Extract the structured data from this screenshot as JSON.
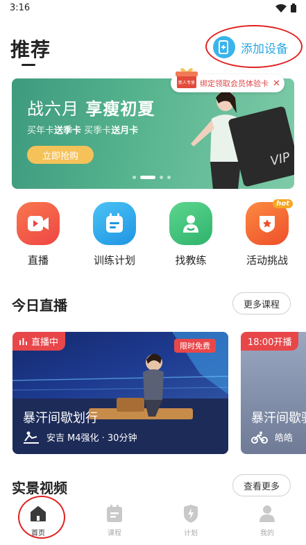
{
  "status_bar": {
    "time": "3:16"
  },
  "header": {
    "title": "推荐",
    "add_device_label": "添加设备"
  },
  "banner": {
    "title_part1": "战六月",
    "title_part2": "享瘦初夏",
    "subtitle_part1": "买年卡",
    "subtitle_part2": "送季卡",
    "subtitle_part3": "买季卡",
    "subtitle_part4": "送月卡",
    "button_label": "立即抢购",
    "card_text": "VIP",
    "slide_count": 4,
    "active_slide": 2
  },
  "bind_card_popup": {
    "gift_text": "新人专享",
    "text": "绑定领取会员体验卡",
    "close_icon": "✕"
  },
  "quick_entries": [
    {
      "label": "直播",
      "icon": "live-video-icon",
      "color": "#f35b4b"
    },
    {
      "label": "训练计划",
      "icon": "calendar-plan-icon",
      "color": "#2aa5e8"
    },
    {
      "label": "找教练",
      "icon": "coach-icon",
      "color": "#3dbf79"
    },
    {
      "label": "活动挑战",
      "icon": "trophy-icon",
      "color": "#f2642b",
      "badge": "hot"
    }
  ],
  "live_section": {
    "title": "今日直播",
    "more_label": "更多课程"
  },
  "live_cards": [
    {
      "status": "直播中",
      "free_tag": "限时免费",
      "name": "暴汗间歇划行",
      "coach": "安吉",
      "meta": "M4强化 · 30分钟"
    },
    {
      "status": "18:00开播",
      "name": "暴汗间歇骑",
      "coach": "皓皓"
    }
  ],
  "scene_section": {
    "title": "实景视频",
    "more_label": "查看更多"
  },
  "tab_bar": [
    {
      "label": "首页",
      "icon": "home-icon",
      "active": true
    },
    {
      "label": "课程",
      "icon": "course-icon",
      "active": false
    },
    {
      "label": "计划",
      "icon": "plan-icon",
      "active": false
    },
    {
      "label": "我的",
      "icon": "profile-icon",
      "active": false
    }
  ],
  "colors": {
    "accent_blue": "#2aa7e0",
    "live_red": "#e8474a",
    "banner_green": "#57b48f"
  }
}
